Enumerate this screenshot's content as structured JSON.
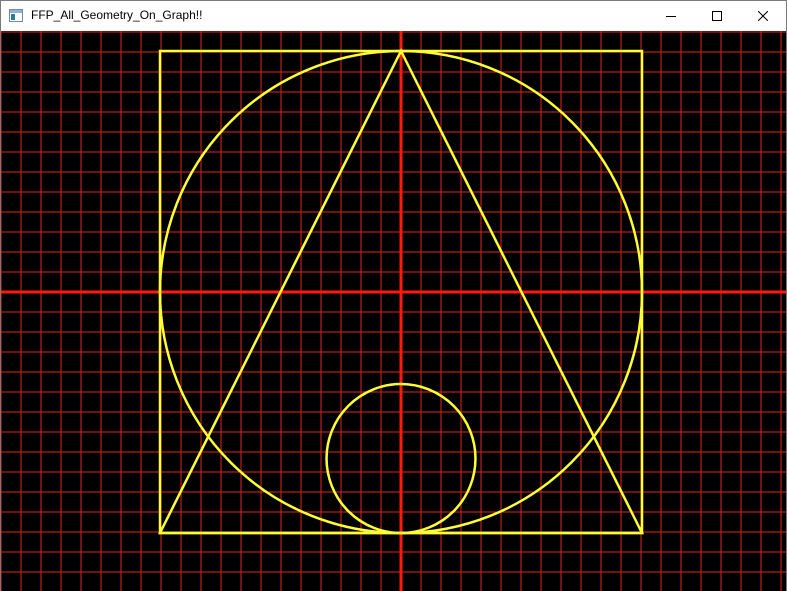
{
  "window": {
    "title": "FFP_All_Geometry_On_Graph!!",
    "icon": "app-window-icon",
    "controls": {
      "minimize_icon": "minimize-icon",
      "maximize_icon": "maximize-icon",
      "close_icon": "close-icon"
    }
  },
  "graph": {
    "background_color": "#000000",
    "grid_color": "#e0241b",
    "axis_color": "#ff1a0d",
    "shape_color": "#ffff33",
    "grid": true,
    "shapes": [
      "square",
      "circumscribed-circle",
      "triangle",
      "inscribed-circle"
    ]
  }
}
